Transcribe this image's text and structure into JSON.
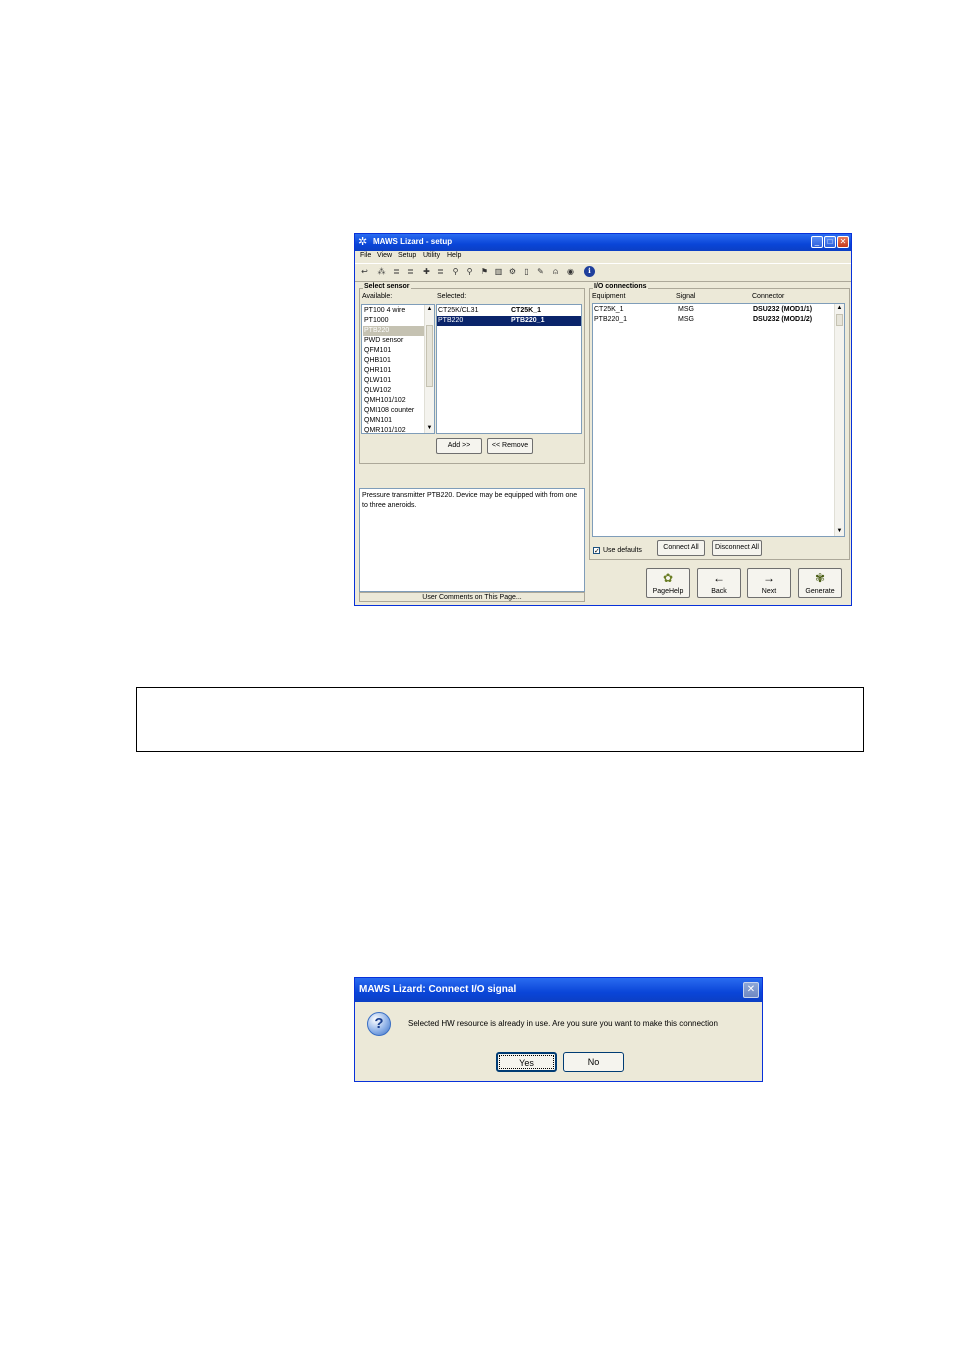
{
  "main_window": {
    "title": "MAWS Lizard - setup",
    "menu": [
      "File",
      "View",
      "Setup",
      "Utility",
      "Help"
    ],
    "toolbar_icons": [
      "back-arrow-icon",
      "network-icon",
      "dev-icon",
      "dev2-icon",
      "flag-icon",
      "ip-icon",
      "person-icon",
      "person2-icon",
      "flag2-icon",
      "meter-icon",
      "bike-icon",
      "page-icon",
      "tool-icon",
      "bell-icon",
      "globe-icon",
      "info-icon"
    ],
    "toolbar_glyphs": [
      "↩",
      "⁂",
      "≣",
      "≣",
      "✚",
      "≣",
      "⚲",
      "⚲",
      "⚑",
      "▥",
      "⚙",
      "▯",
      "✎",
      "⍝",
      "◉",
      "ℹ"
    ],
    "select_sensor": {
      "title": "Select sensor",
      "available_label": "Available:",
      "selected_label": "Selected:",
      "available": [
        "PT100 4 wire",
        "PT1000",
        "PTB220",
        "PWD sensor",
        "QFM101",
        "QHB101",
        "QHR101",
        "QLW101",
        "QLW102",
        "QMH101/102",
        "QMI108 counter",
        "QMN101",
        "QMR101/102"
      ],
      "available_highlight": "PTB220",
      "selected": [
        {
          "type": "CT25K/CL31",
          "name": "CT25K_1"
        },
        {
          "type": "PTB220",
          "name": "PTB220_1"
        }
      ],
      "add_button": "Add >>",
      "remove_button": "<< Remove"
    },
    "description": "Pressure transmitter PTB220. Device may be equipped with from one to three aneroids.",
    "comments_label": "User Comments on This Page...",
    "io_connections": {
      "title": "I/O connections",
      "headers": [
        "Equipment",
        "Signal",
        "Connector"
      ],
      "rows": [
        {
          "equipment": "CT25K_1",
          "signal": "MSG",
          "connector": "DSU232 (MOD1/1)"
        },
        {
          "equipment": "PTB220_1",
          "signal": "MSG",
          "connector": "DSU232 (MOD1/2)"
        }
      ],
      "use_defaults": "Use defaults",
      "connect_all": "Connect All",
      "disconnect_all": "Disconnect All"
    },
    "nav": {
      "pagehelp": "PageHelp",
      "back": "Back",
      "next": "Next",
      "generate": "Generate"
    }
  },
  "dialog": {
    "title": "MAWS Lizard: Connect I/O signal",
    "message": "Selected HW resource is already in use. Are you sure you want to make this connection",
    "yes": "Yes",
    "no": "No"
  }
}
